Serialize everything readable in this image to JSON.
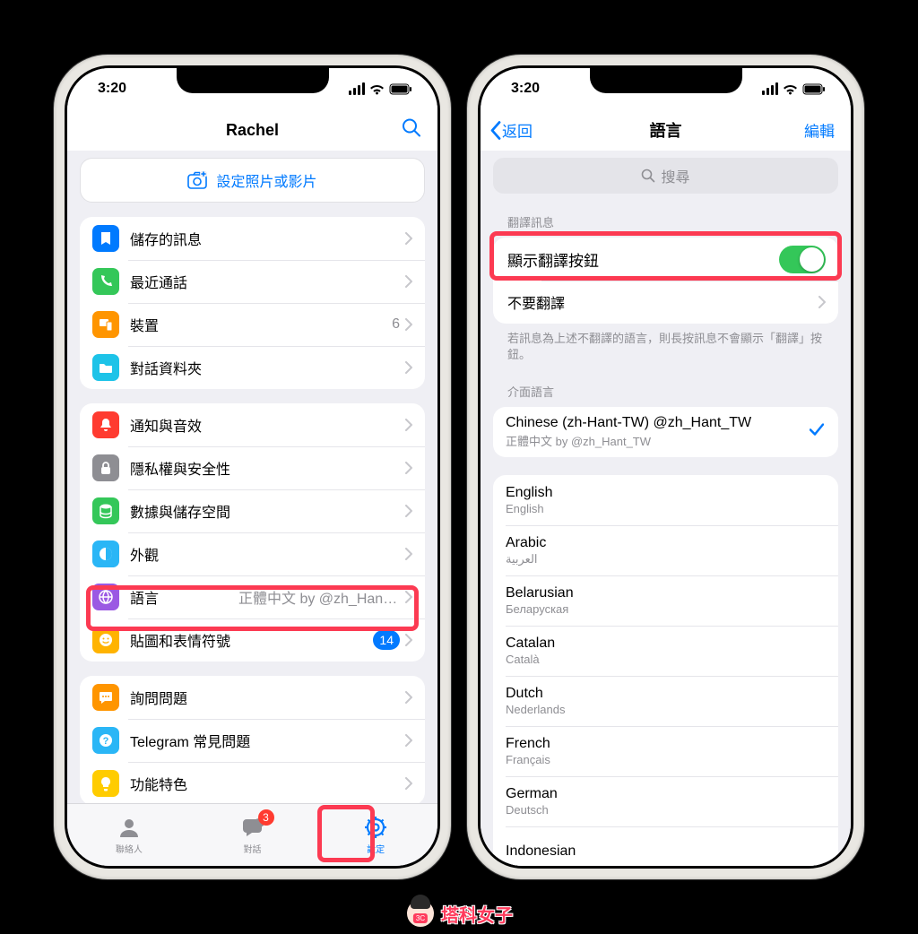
{
  "status": {
    "time": "3:20"
  },
  "left": {
    "title": "Rachel",
    "photo_button": "設定照片或影片",
    "groups": [
      {
        "rows": [
          {
            "icon": "bookmark-icon",
            "bg": "bg-blue",
            "label": "儲存的訊息"
          },
          {
            "icon": "phone-icon",
            "bg": "bg-green",
            "label": "最近通話"
          },
          {
            "icon": "devices-icon",
            "bg": "bg-orange",
            "label": "裝置",
            "value": "6"
          },
          {
            "icon": "folder-icon",
            "bg": "bg-cyan",
            "label": "對話資料夾"
          }
        ]
      },
      {
        "rows": [
          {
            "icon": "bell-icon",
            "bg": "bg-red",
            "label": "通知與音效"
          },
          {
            "icon": "lock-icon",
            "bg": "bg-gray",
            "label": "隱私權與安全性"
          },
          {
            "icon": "data-icon",
            "bg": "bg-emerald",
            "label": "數據與儲存空間"
          },
          {
            "icon": "appearance-icon",
            "bg": "bg-lightblue",
            "label": "外觀"
          },
          {
            "icon": "globe-icon",
            "bg": "bg-purple",
            "label": "語言",
            "value": "正體中文 by @zh_Hant_TW",
            "highlight": true
          },
          {
            "icon": "sticker-icon",
            "bg": "bg-amber",
            "label": "貼圖和表情符號",
            "badge": "14"
          }
        ]
      },
      {
        "rows": [
          {
            "icon": "chat-icon",
            "bg": "bg-orange2",
            "label": "詢問問題"
          },
          {
            "icon": "faq-icon",
            "bg": "bg-lightblue",
            "label": "Telegram 常見問題"
          },
          {
            "icon": "bulb-icon",
            "bg": "bg-yellow",
            "label": "功能特色"
          }
        ]
      }
    ],
    "tabs": {
      "contacts": "聯絡人",
      "chats": "對話",
      "chats_badge": "3",
      "settings": "設定"
    }
  },
  "right": {
    "back": "返回",
    "title": "語言",
    "edit": "編輯",
    "search_placeholder": "搜尋",
    "sec1_header": "翻譯訊息",
    "show_translate": "顯示翻譯按鈕",
    "dont_translate": "不要翻譯",
    "footnote": "若訊息為上述不翻譯的語言，則長按訊息不會顯示「翻譯」按鈕。",
    "sec2_header": "介面語言",
    "current": {
      "name": "Chinese (zh-Hant-TW) @zh_Hant_TW",
      "native": "正體中文 by @zh_Hant_TW"
    },
    "languages": [
      {
        "name": "English",
        "native": "English"
      },
      {
        "name": "Arabic",
        "native": "العربية"
      },
      {
        "name": "Belarusian",
        "native": "Беларуская"
      },
      {
        "name": "Catalan",
        "native": "Català"
      },
      {
        "name": "Dutch",
        "native": "Nederlands"
      },
      {
        "name": "French",
        "native": "Français"
      },
      {
        "name": "German",
        "native": "Deutsch"
      },
      {
        "name": "Indonesian",
        "native": ""
      }
    ]
  },
  "mascot": "塔科女子"
}
